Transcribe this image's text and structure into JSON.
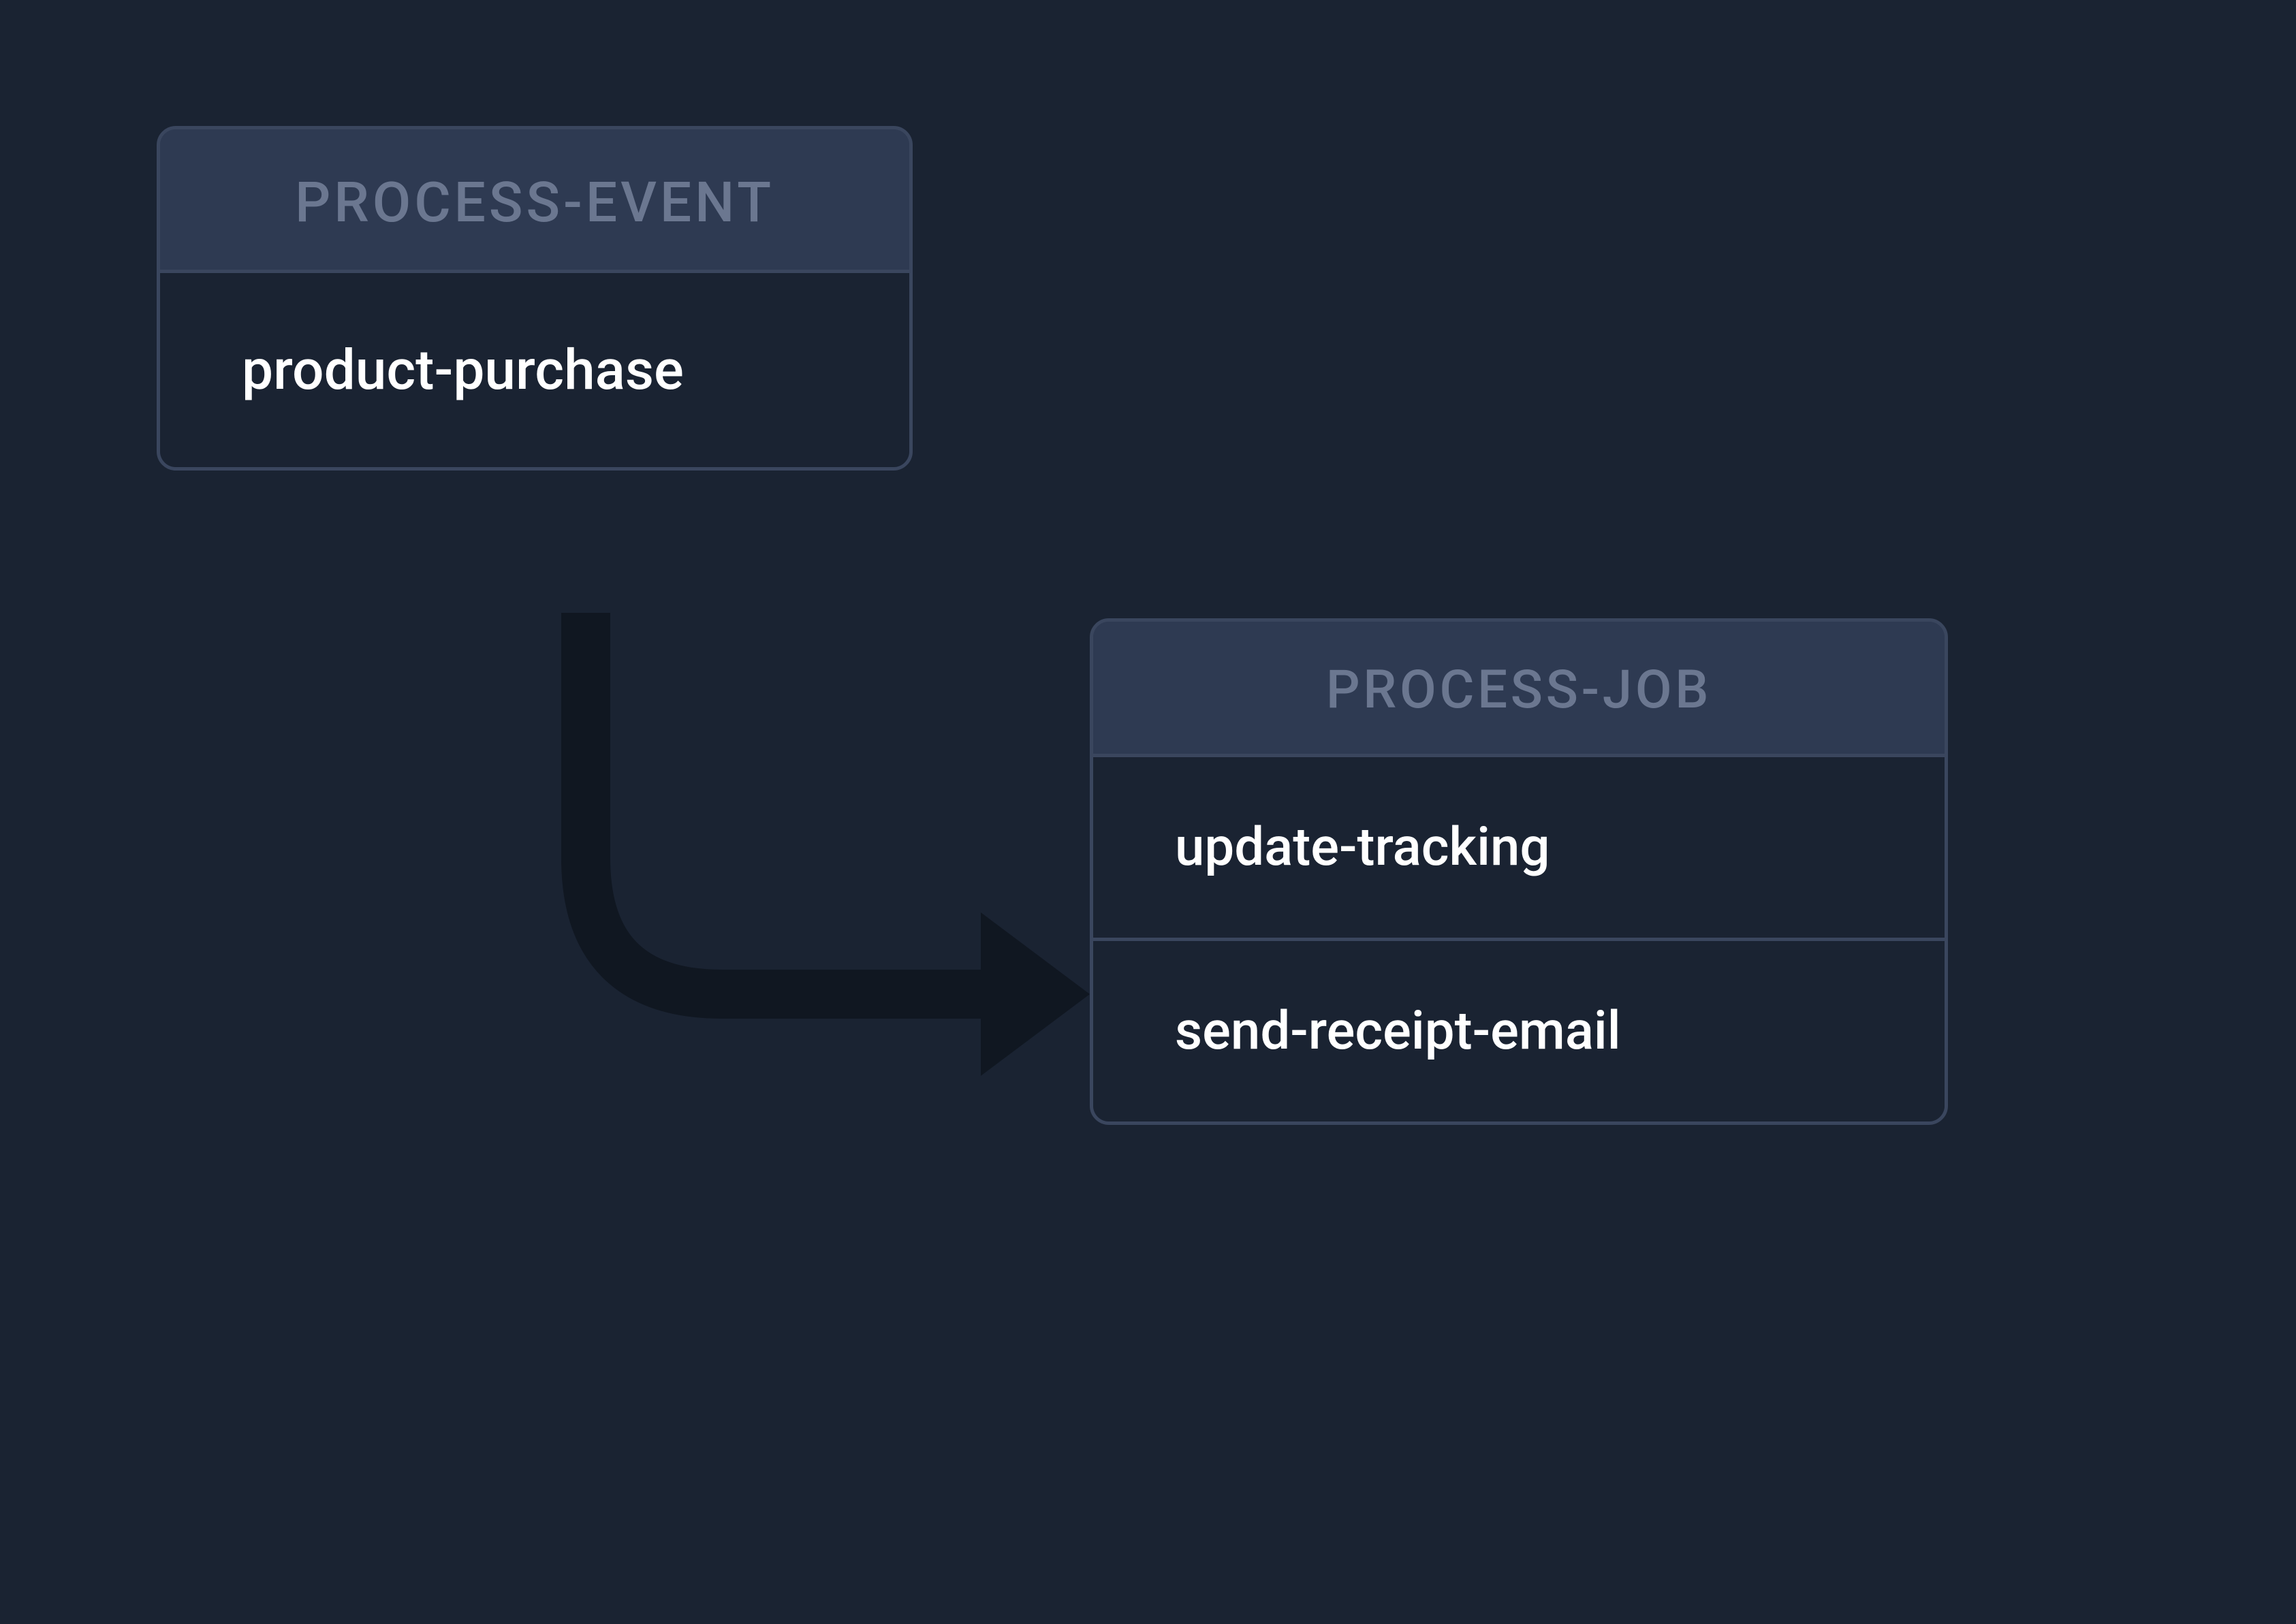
{
  "diagram": {
    "nodes": {
      "event": {
        "title": "PROCESS-EVENT",
        "items": [
          "product-purchase"
        ]
      },
      "job": {
        "title": "PROCESS-JOB",
        "items": [
          "update-tracking",
          "send-receipt-email"
        ]
      }
    },
    "arrow": {
      "from": "event",
      "to": "job"
    },
    "colors": {
      "background": "#1a2332",
      "panel": "#2e3a52",
      "border": "#3a465e",
      "header_text": "#6b7790",
      "body_text": "#ffffff",
      "arrow": "#101721"
    }
  }
}
